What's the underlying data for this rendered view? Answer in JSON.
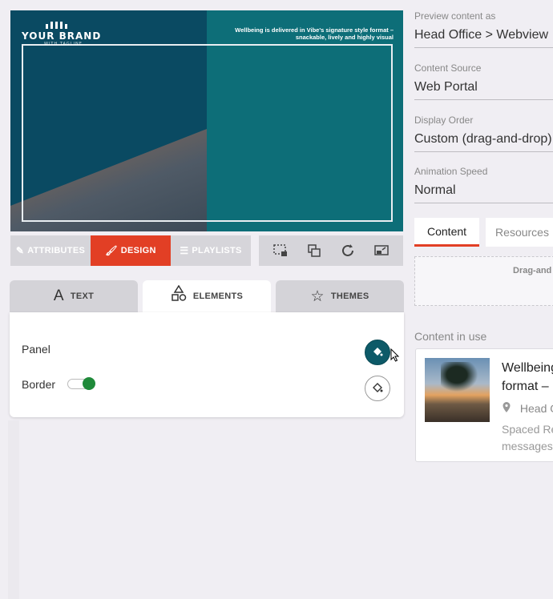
{
  "preview": {
    "brand_name": "YOUR BRAND",
    "brand_tagline": "WITH TAGLINE",
    "headline": "Wellbeing is delivered in Vibe's signature style format – snackable, lively and highly visual"
  },
  "mode_tabs": [
    {
      "label": "ATTRIBUTES",
      "icon": "edit-icon"
    },
    {
      "label": "DESIGN",
      "icon": "brush-icon",
      "active": true
    },
    {
      "label": "PLAYLISTS",
      "icon": "list-icon"
    }
  ],
  "tools": [
    "crop-screenshot-icon",
    "layers-icon",
    "refresh-icon",
    "cast-icon"
  ],
  "subtabs": [
    {
      "label": "TEXT",
      "icon": "text-icon"
    },
    {
      "label": "ELEMENTS",
      "icon": "shapes-icon",
      "active": true
    },
    {
      "label": "THEMES",
      "icon": "star-icon"
    }
  ],
  "elements": {
    "panel_label": "Panel",
    "border_label": "Border",
    "border_enabled": true
  },
  "right": {
    "preview_as_label": "Preview content as",
    "preview_as_value": "Head Office > Webview",
    "source_label": "Content Source",
    "source_value": "Web Portal",
    "order_label": "Display Order",
    "order_value": "Custom (drag-and-drop)",
    "speed_label": "Animation Speed",
    "speed_value": "Normal",
    "tab_content": "Content",
    "tab_resources": "Resources",
    "drop_text": "Drag-and",
    "in_use_label": "Content in use",
    "item_title_line1": "Wellbeing",
    "item_title_line2": "format –",
    "item_location": "Head O",
    "item_desc_line1": "Spaced Re",
    "item_desc_line2": "messages"
  },
  "colors": {
    "accent": "#e23f25",
    "preview_dark": "#0a4a62",
    "preview_teal": "#0d6e78",
    "toggle_on": "#1f8a3a"
  }
}
